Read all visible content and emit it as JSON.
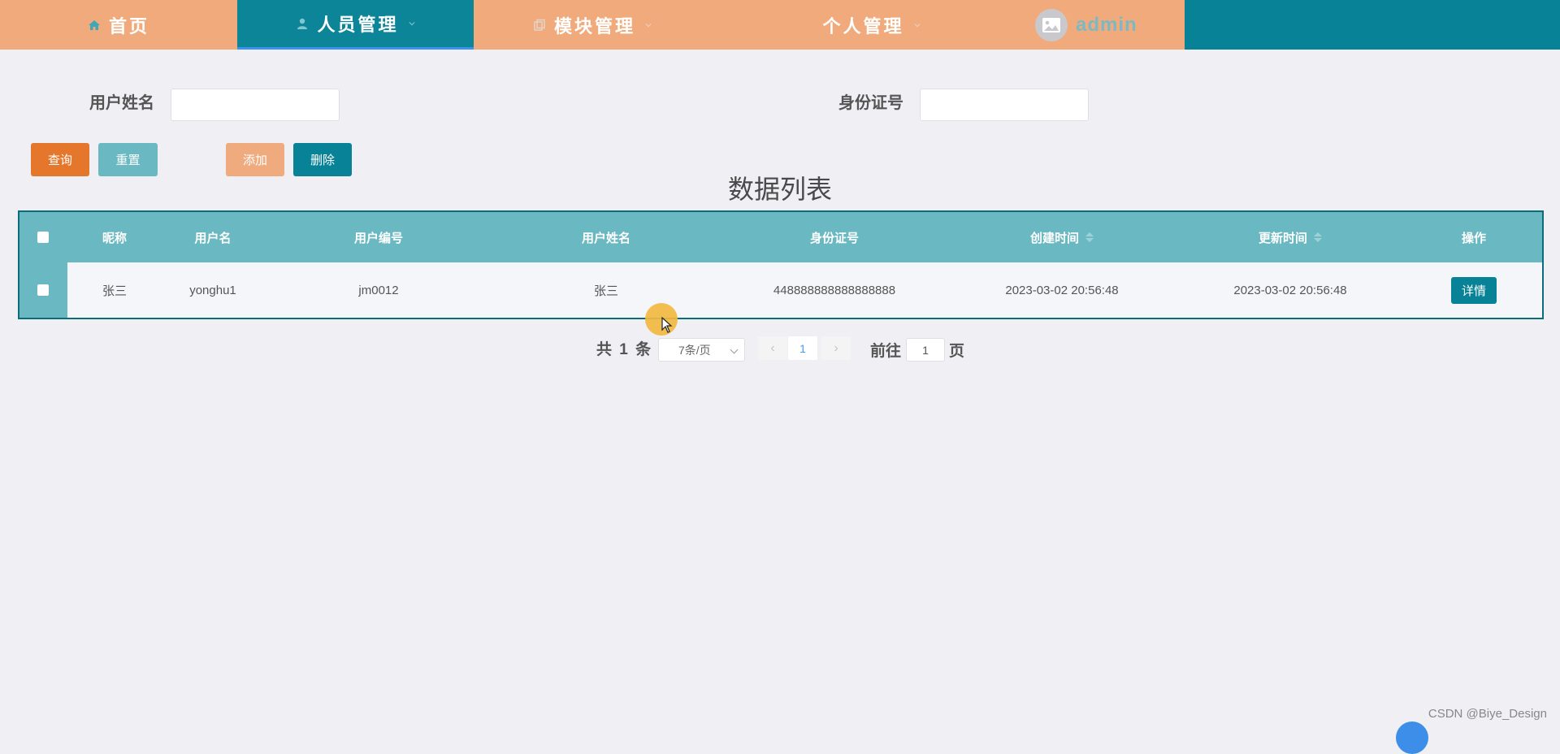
{
  "nav": {
    "items": [
      {
        "label": "首页",
        "icon": "home-icon"
      },
      {
        "label": "人员管理",
        "icon": "person-icon",
        "active": true
      },
      {
        "label": "模块管理",
        "icon": "copy-icon"
      },
      {
        "label": "个人管理"
      }
    ],
    "user": {
      "name": "admin",
      "avatar_icon": "image-icon"
    },
    "colors": {
      "bar": "#088296",
      "item": "#f0aa7b"
    }
  },
  "search": {
    "name_label": "用户姓名",
    "name_value": "",
    "id_label": "身份证号",
    "id_value": ""
  },
  "toolbar": {
    "query": "查询",
    "reset": "重置",
    "add": "添加",
    "delete": "删除"
  },
  "page_title": "数据列表",
  "table": {
    "columns": [
      "昵称",
      "用户名",
      "用户编号",
      "用户姓名",
      "身份证号",
      "创建时间",
      "更新时间",
      "操作"
    ],
    "sortable": [
      "创建时间",
      "更新时间"
    ],
    "rows": [
      {
        "nickname": "张三",
        "username": "yonghu1",
        "user_no": "jm0012",
        "real_name": "张三",
        "id_card": "448888888888888888",
        "created": "2023-03-02 20:56:48",
        "updated": "2023-03-02 20:56:48",
        "action": "详情"
      }
    ]
  },
  "pagination": {
    "total_text": "共 1 条",
    "page_size": "7条/页",
    "prev": "‹",
    "current": "1",
    "next": "›",
    "goto_prefix": "前往",
    "goto_value": "1",
    "goto_suffix": "页"
  },
  "watermark": "CSDN @Biye_Design"
}
